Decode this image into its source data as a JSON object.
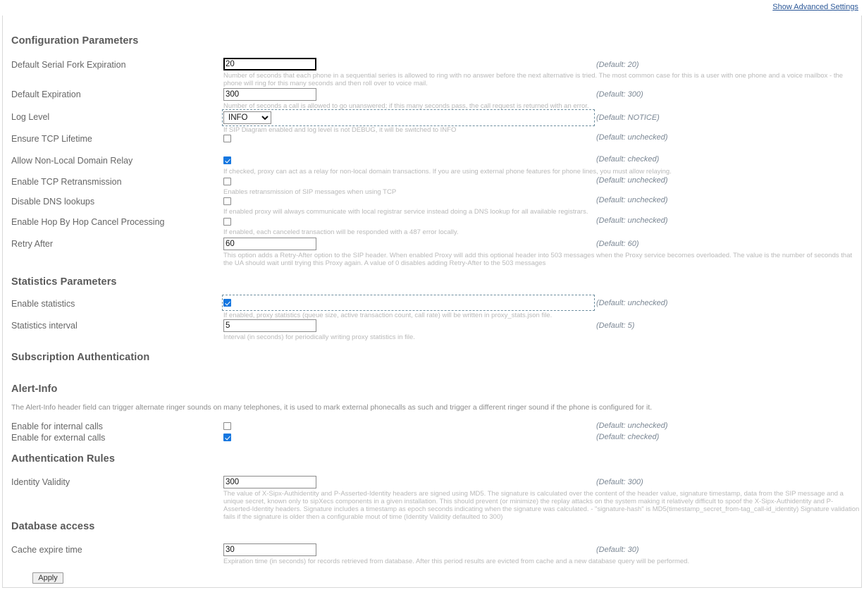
{
  "advanced_link": "Show Advanced Settings",
  "sections": {
    "configuration": {
      "heading": "Configuration Parameters",
      "rows": [
        {
          "label": "Default Serial Fork Expiration",
          "value": "20",
          "default": "(Default: 20)",
          "help": "Number of seconds that each phone in a sequential series is allowed to ring with no answer before the next alternative is tried. The most common case for this is a user with one phone and a voice mailbox - the phone will ring for this many seconds and then roll over to voice mail."
        },
        {
          "label": "Default Expiration",
          "value": "300",
          "default": "(Default: 300)",
          "help": "Number of seconds a call is allowed to go unanswered; if this many seconds pass, the call request is returned with an error."
        },
        {
          "label": "Log Level",
          "value": "INFO",
          "options": [
            "INFO"
          ],
          "default": "(Default: NOTICE)",
          "help": "If SIP Diagram enabled and log level is not DEBUG, it will be switched to INFO"
        },
        {
          "label": "Ensure TCP Lifetime",
          "checked": false,
          "default": "(Default: unchecked)",
          "help": ""
        },
        {
          "label": "Allow Non-Local Domain Relay",
          "checked": true,
          "default": "(Default: checked)",
          "help": "If checked, proxy can act as a relay for non-local domain transactions. If you are using external phone features for phone lines, you must allow relaying."
        },
        {
          "label": "Enable TCP Retransmission",
          "checked": false,
          "default": "(Default: unchecked)",
          "help": "Enables retransmission of SIP messages when using TCP"
        },
        {
          "label": "Disable DNS lookups",
          "checked": false,
          "default": "(Default: unchecked)",
          "help": "If enabled proxy will always communicate with local registrar service instead doing a DNS lookup for all available registrars."
        },
        {
          "label": "Enable Hop By Hop Cancel Processing",
          "checked": false,
          "default": "(Default: unchecked)",
          "help": "If enabled, each canceled transaction will be responded with a 487 error locally."
        },
        {
          "label": "Retry After",
          "value": "60",
          "default": "(Default: 60)",
          "help": "This option adds a Retry-After option to the SIP header. When enabled Proxy will add this optional header into 503 messages when the Proxy service becomes overloaded. The value is the number of seconds that the UA should wait until trying this Proxy again. A value of 0 disables adding Retry-After to the 503 messages"
        }
      ]
    },
    "statistics": {
      "heading": "Statistics Parameters",
      "rows": [
        {
          "label": "Enable statistics",
          "checked": true,
          "default": "(Default: unchecked)",
          "help": "If enabled, proxy statistics (queue size, active transaction count, call rate) will be written in proxy_stats.json file."
        },
        {
          "label": "Statistics interval",
          "value": "5",
          "default": "(Default: 5)",
          "help": "Interval (in seconds) for periodically writing proxy statistics in file."
        }
      ]
    },
    "subscription_authentication": {
      "heading": "Subscription Authentication"
    },
    "alert_info": {
      "heading": "Alert-Info",
      "intro": "The Alert-Info header field can trigger alternate ringer sounds on many telephones, it is used to mark external phonecalls as such and trigger a different ringer sound if the phone is configured for it.",
      "rows": [
        {
          "label": "Enable for internal calls",
          "checked": false,
          "default": "(Default: unchecked)"
        },
        {
          "label": "Enable for external calls",
          "checked": true,
          "default": "(Default: checked)"
        }
      ]
    },
    "authentication_rules": {
      "heading": "Authentication Rules",
      "rows": [
        {
          "label": "Identity Validity",
          "value": "300",
          "default": "(Default: 300)",
          "help": "The value of X-Sipx-Authidentity and P-Asserted-Identity headers are signed using MD5. The signature is calculated over the content of the header value, signature timestamp, data from the SIP message and a unique secret, known only to sipXecs components in a given installation. This should prevent (or minimize) the replay attacks on the system making it relatively difficult to spoof the X-Sipx-Authidentity and P-Asserted-Identity headers. Signature includes a timestamp as epoch seconds indicating when the signature was calculated. - \"signature-hash\" is MD5(timestamp_secret_from-tag_call-id_identity) Signature validation fails if the signature is older then a configurable mout of time (Identity Validity defaulted to 300)"
        }
      ]
    },
    "database_access": {
      "heading": "Database access",
      "rows": [
        {
          "label": "Cache expire time",
          "value": "30",
          "default": "(Default: 30)",
          "help": "Expiration time (in seconds) for records retrieved from database. After this period results are evicted from cache and a new database query will be performed."
        }
      ]
    }
  },
  "apply_button": "Apply",
  "colors": {
    "link": "#2b5797",
    "checkbox_checked": "#1677e0",
    "focus_dash": "#6f8fa0",
    "label": "#666666",
    "help": "#b9b9b9"
  }
}
